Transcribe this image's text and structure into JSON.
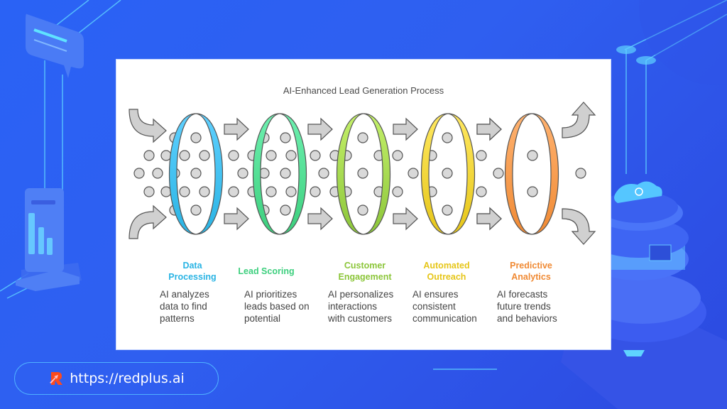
{
  "diagram": {
    "title": "AI-Enhanced Lead Generation Process",
    "stages": [
      {
        "title_line1": "Data",
        "title_line2": "Processing",
        "color": "#2ab4e4",
        "ring_color": "#5fd0ff",
        "desc": [
          "AI analyzes",
          "data to find",
          "patterns"
        ]
      },
      {
        "title_line1": "Lead Scoring",
        "title_line2": "",
        "color": "#3ccf7d",
        "ring_color": "#6ef0b0",
        "desc": [
          "AI prioritizes",
          "leads based on",
          "potential"
        ]
      },
      {
        "title_line1": "Customer",
        "title_line2": "Engagement",
        "color": "#8cc63a",
        "ring_color": "#c4f06a",
        "desc": [
          "AI personalizes",
          "interactions",
          "with customers"
        ]
      },
      {
        "title_line1": "Automated",
        "title_line2": "Outreach",
        "color": "#e6c619",
        "ring_color": "#ffe860",
        "desc": [
          "AI ensures",
          "consistent",
          "communication"
        ]
      },
      {
        "title_line1": "Predictive",
        "title_line2": "Analytics",
        "color": "#f08a34",
        "ring_color": "#ffb270",
        "desc": [
          "AI forecasts",
          "future trends",
          "and behaviors"
        ]
      }
    ]
  },
  "footer": {
    "url": "https://redplus.ai",
    "logo_icon": "redplus-logo-icon"
  },
  "colors": {
    "background": "#2a62f5",
    "dot_fill": "#d9d9d9",
    "arrow_fill": "#d0d0d0",
    "outline": "#555555"
  }
}
